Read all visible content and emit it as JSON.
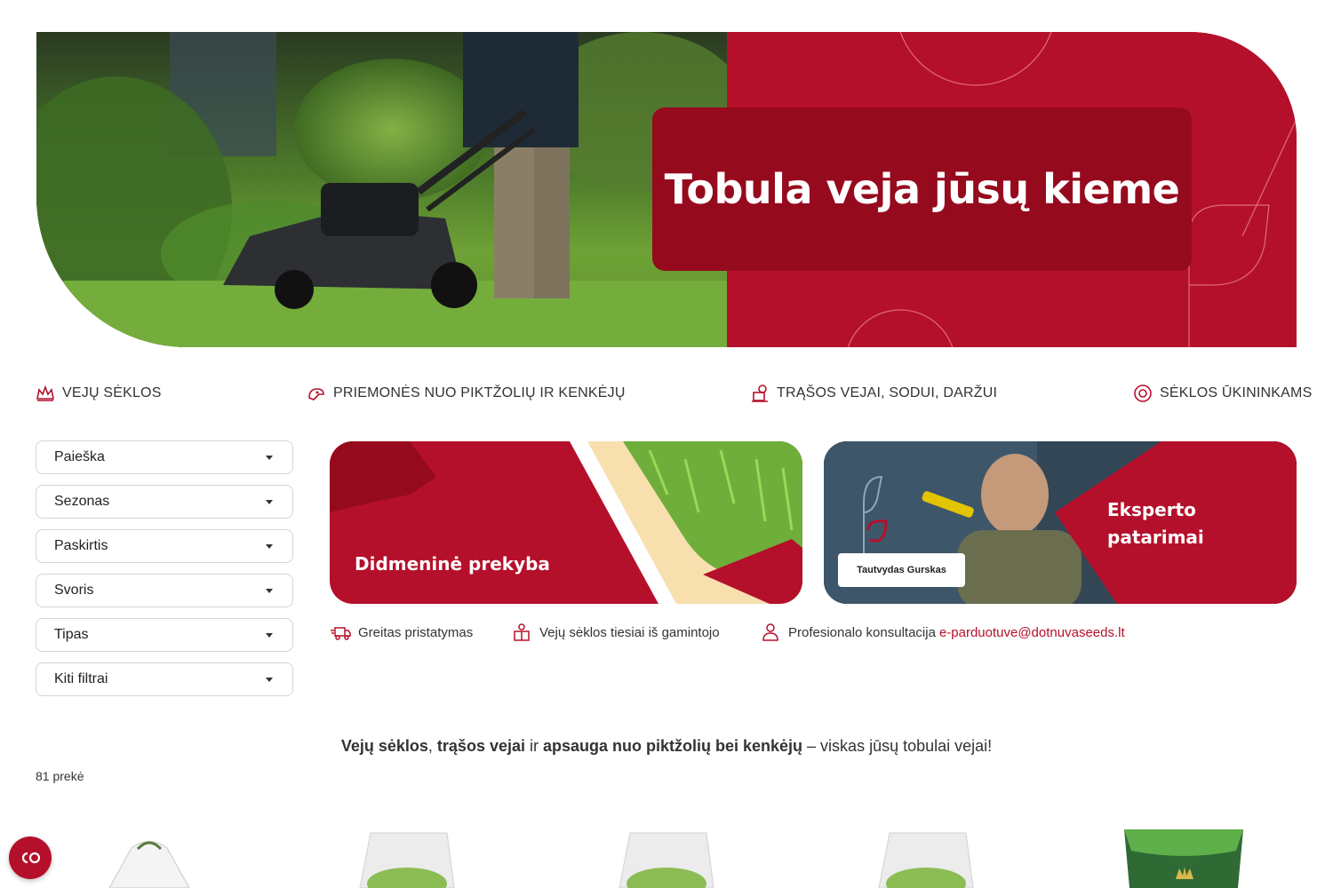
{
  "hero": {
    "title": "Tobula veja jūsų kieme"
  },
  "categories": [
    {
      "label": "VEJŲ SĖKLOS",
      "icon": "crown-grass-icon"
    },
    {
      "label": "PRIEMONĖS NUO PIKTŽOLIŲ IR KENKĖJŲ",
      "icon": "pest-spray-icon"
    },
    {
      "label": "TRĄŠOS VEJAI, SODUI, DARŽUI",
      "icon": "fertilizer-icon"
    },
    {
      "label": "SĖKLOS ŪKININKAMS",
      "icon": "seed-badge-icon"
    }
  ],
  "filters": [
    "Paieška",
    "Sezonas",
    "Paskirtis",
    "Svoris",
    "Tipas",
    "Kiti filtrai"
  ],
  "promos": {
    "wholesale": "Didmeninė prekyba",
    "expert": "Eksperto patarimai",
    "expert_name": "Tautvydas Gurskas"
  },
  "benefits": {
    "delivery": "Greitas pristatymas",
    "manufacturer": "Vejų sėklos tiesiai iš gamintojo",
    "consultation": "Profesionalo konsultacija",
    "email": "e-parduotuve@dotnuvaseeds.lt"
  },
  "tagline": {
    "part1": "Vejų sėklos",
    "sep1": ", ",
    "part2": "trąšos vejai",
    "sep2": " ir ",
    "part3": "apsauga nuo piktžolių bei kenkėjų",
    "rest": " – viskas jūsų tobulai vejai!"
  },
  "product_count": "81 prekė",
  "colors": {
    "brand_red": "#b5102b",
    "dark_red": "#960a1e"
  }
}
